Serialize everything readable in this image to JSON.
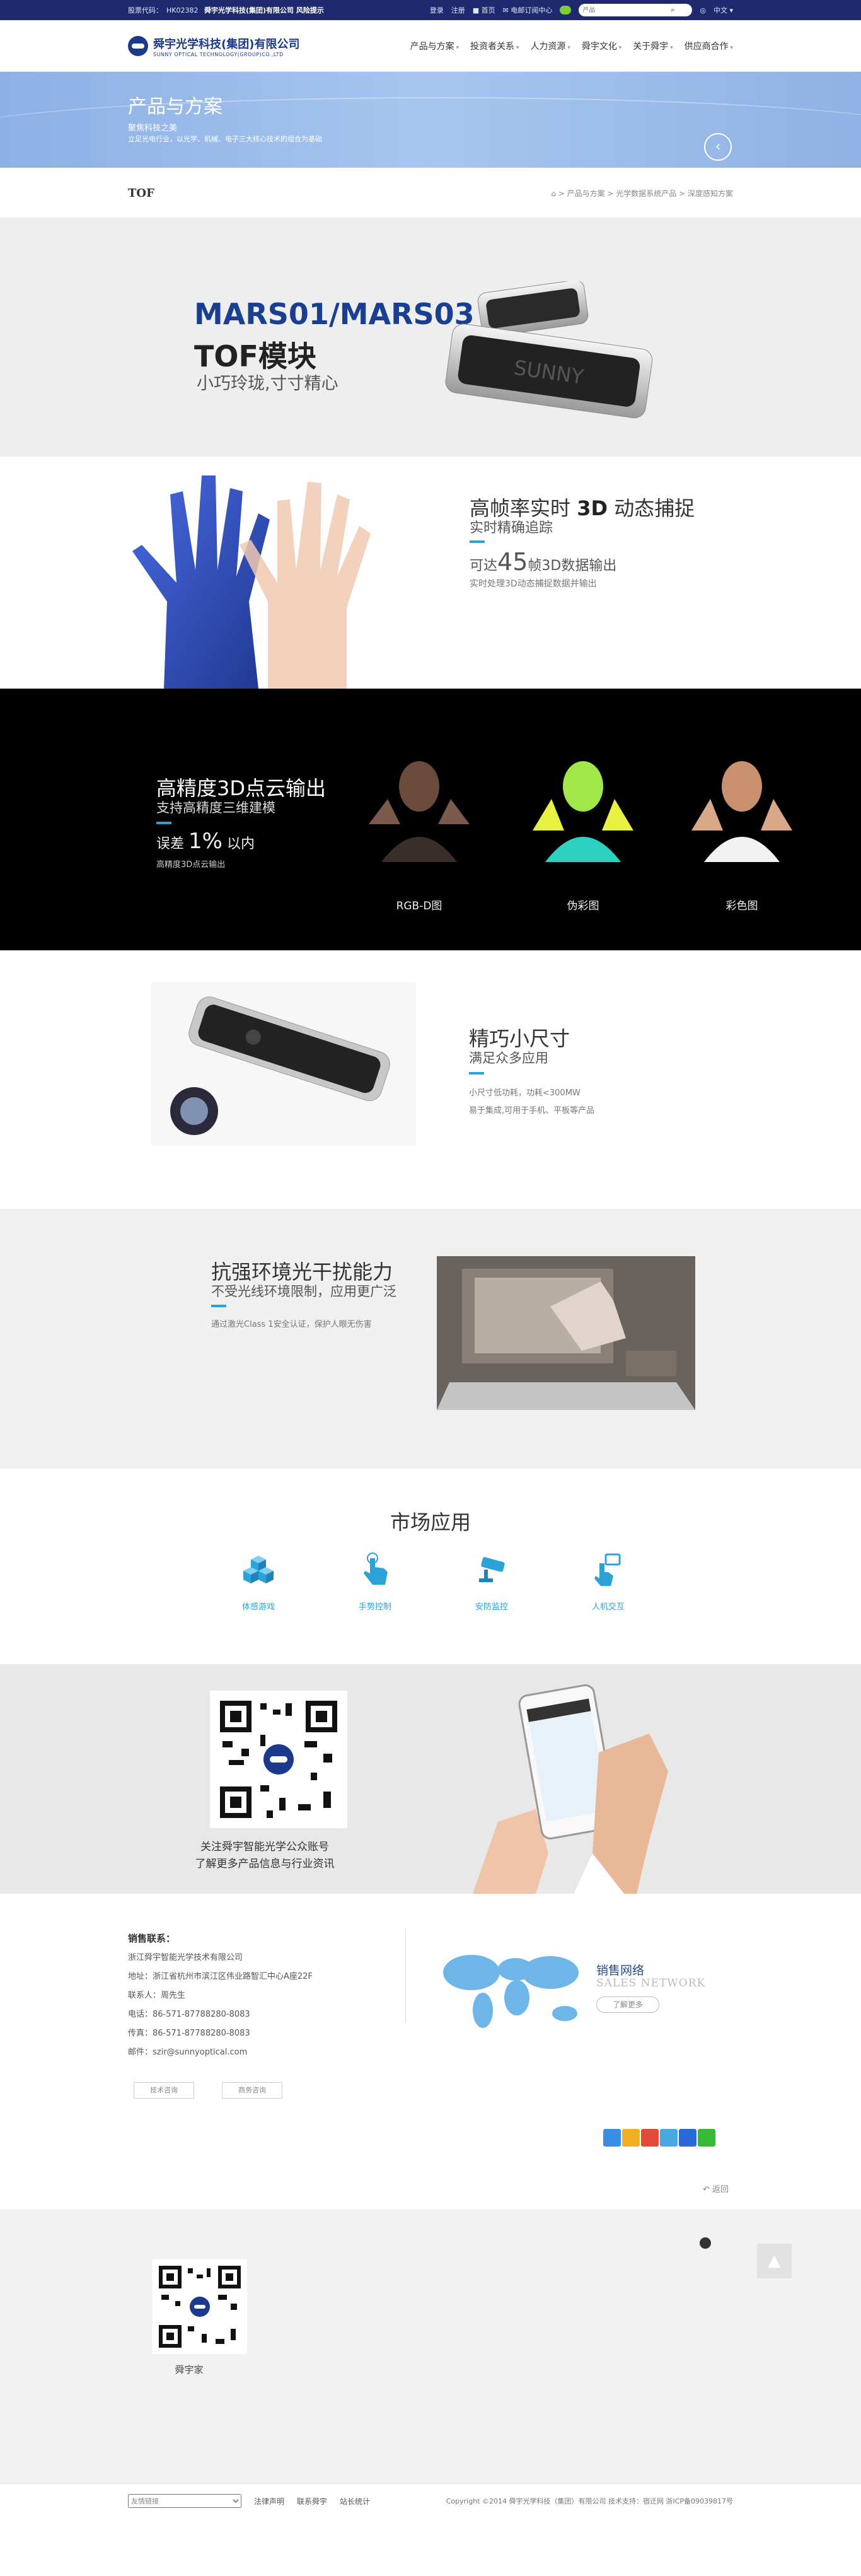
{
  "topbar": {
    "stock_label": "股票代码：",
    "stock_code": "HK02382",
    "notice": "舜宇光学科技(集团)有限公司  风险提示",
    "login": "登录",
    "register": "注册",
    "home": "首页",
    "ecommerce": "电邮订阅中心",
    "search_placeholder": "产品",
    "lang": "中文"
  },
  "header": {
    "logo_name": "舜宇光学科技(集团)有限公司",
    "logo_en": "SUNNY OPTICAL TECHNOLOGY(GROUP)CO.,LTD",
    "nav": [
      "产品与方案",
      "投资者关系",
      "人力资源",
      "舜宇文化",
      "关于舜宇",
      "供应商合作"
    ]
  },
  "hero": {
    "title": "产品与方案",
    "sub1": "聚焦科技之美",
    "sub2": "立足光电行业，以光学、机械、电子三大核心技术的组合为基础"
  },
  "crumb": {
    "page": "TOF",
    "path": "> 产品与方案 > 光学数据系统产品 > 深度感知方案"
  },
  "product": {
    "model": "MARS01/MARS03",
    "name": "TOF模块",
    "slogan": "小巧玲珑,寸寸精心"
  },
  "sec1": {
    "title_a": "高帧率实时 ",
    "title_b": "3D",
    "title_c": " 动态捕捉",
    "sub": "实时精确追踪",
    "num_pre": "可达",
    "num": "45",
    "num_post": "帧3D数据输出",
    "desc": "实时处理3D动态捕捉数据并输出"
  },
  "sec2": {
    "title": "高精度3D点云输出",
    "sub": "支持高精度三维建模",
    "err_pre": "误差 ",
    "err": "1%",
    "err_post": " 以内",
    "desc": "高精度3D点云输出",
    "captions": [
      "RGB-D图",
      "伪彩图",
      "彩色图"
    ]
  },
  "sec3": {
    "title": "精巧小尺寸",
    "sub": "满足众多应用",
    "d1": "小尺寸低功耗，功耗<300MW",
    "d2": "易于集成,可用于手机、平板等产品"
  },
  "sec4": {
    "title": "抗强环境光干扰能力",
    "sub": "不受光线环境限制，应用更广泛",
    "desc": "通过激光Class 1安全认证，保护人眼无伤害"
  },
  "sec5": {
    "title": "市场应用",
    "apps": [
      "体感游戏",
      "手势控制",
      "安防监控",
      "人机交互"
    ]
  },
  "sec6": {
    "cap1": "关注舜宇智能光学公众账号",
    "cap2": "了解更多产品信息与行业资讯"
  },
  "contact": {
    "head": "销售联系：",
    "company": "浙江舜宇智能光学技术有限公司",
    "address": "地址：浙江省杭州市滨江区伟业路智汇中心A座22F",
    "person": "联系人：周先生",
    "tel": "电话：86-571-87788280-8083",
    "fax": "传真：86-571-87788280-8083",
    "email": "邮件：szir@sunnyoptical.com",
    "btn1": "技术咨询",
    "btn2": "商务咨询",
    "network_cn": "销售网络",
    "network_en": "SALES NETWORK",
    "more": "了解更多",
    "back": "返回"
  },
  "bottom": {
    "qr_caption": "舜宇家"
  },
  "footer": {
    "links_placeholder": "友情链接",
    "links": [
      "法律声明",
      "联系舜宇",
      "站长统计"
    ],
    "copyright": "Copyright ©2014 舜宇光学科技（集团）有限公司 技术支持：宿迁网 浙ICP备09039817号"
  },
  "colors": {
    "brand": "#1f2a6e",
    "accent": "#2ba3d8"
  }
}
